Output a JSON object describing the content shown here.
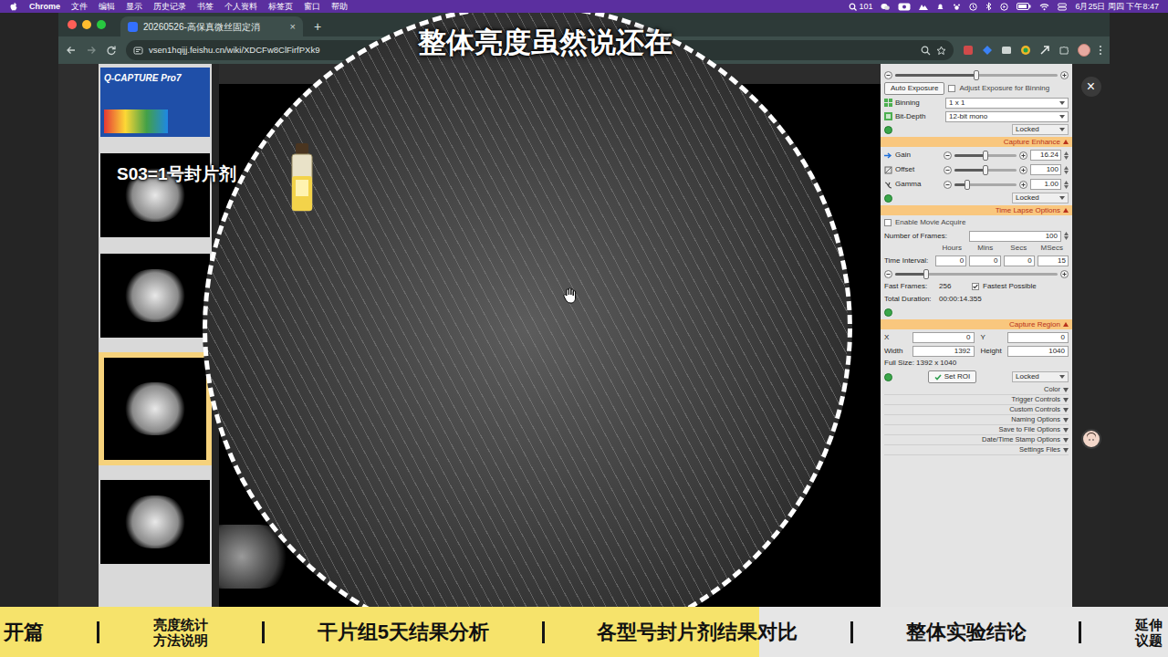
{
  "menubar": {
    "app": "Chrome",
    "menus": [
      "文件",
      "编辑",
      "显示",
      "历史记录",
      "书签",
      "个人资料",
      "标签页",
      "窗口",
      "帮助"
    ],
    "badge": "101",
    "clock": "6月25日 周四 下午8:47"
  },
  "browser": {
    "tabs": [
      {
        "title": "20260526-高保真微丝固定消",
        "selected": true
      }
    ],
    "tab_close": "×",
    "new_tab": "+",
    "url": "vsen1hqijj.feishu.cn/wiki/XDCFw8ClFirfPXk9"
  },
  "viewer": {
    "close": "×",
    "thumbnails": [
      {
        "kind": "logo",
        "label": "Q-CAPTURE Pro7",
        "selected": false
      },
      {
        "kind": "image",
        "selected": false
      },
      {
        "kind": "image",
        "selected": false
      },
      {
        "kind": "image",
        "selected": true
      },
      {
        "kind": "image",
        "selected": false
      }
    ]
  },
  "capture_panel": {
    "exposure_slider": {
      "level": 0.5
    },
    "auto_exposure": "Auto Exposure",
    "adjust_binning": {
      "label": "Adjust Exposure for Binning",
      "checked": false
    },
    "binning": {
      "label": "Binning",
      "value": "1 x 1"
    },
    "bit_depth": {
      "label": "Bit-Depth",
      "value": "12-bit mono"
    },
    "lock": "Locked",
    "enhance": {
      "title": "Capture Enhance",
      "sliders": [
        {
          "label": "Gain",
          "value": "16.24",
          "level": 0.5
        },
        {
          "label": "Offset",
          "value": "100",
          "level": 0.5
        },
        {
          "label": "Gamma",
          "value": "1.00",
          "level": 0.2
        }
      ],
      "lock": "Locked"
    },
    "time_lapse": {
      "title": "Time Lapse Options",
      "movie": {
        "label": "Enable Movie Acquire",
        "checked": false
      },
      "frames_label": "Number of Frames:",
      "frames": "100",
      "units": [
        "Hours",
        "Mins",
        "Secs",
        "MSecs"
      ],
      "interval_label": "Time Interval:",
      "interval": [
        "0",
        "0",
        "0",
        "15"
      ],
      "slider": {
        "level": 0.19
      },
      "fast_frames_label": "Fast Frames:",
      "fast_frames": "256",
      "fastest": {
        "label": "Fastest Possible",
        "checked": true
      },
      "duration_label": "Total Duration:",
      "duration": "00:00:14.355"
    },
    "region": {
      "title": "Capture Region",
      "x_label": "X",
      "x": "0",
      "y_label": "Y",
      "y": "0",
      "width_label": "Width",
      "width": "1392",
      "height_label": "Height",
      "height": "1040",
      "full_size": "Full Size: 1392 x 1040",
      "set_roi": "Set ROI",
      "lock": "Locked"
    },
    "sections": [
      "Color",
      "Trigger Controls",
      "Custom Controls",
      "Naming Options",
      "Save to File Options",
      "Date/Time Stamp Options",
      "Settings Files"
    ]
  },
  "overlay": {
    "caption": "整体亮度虽然说还在",
    "label": "S03=1号封片剂"
  },
  "chapters": {
    "progress": {
      "level": 0.65
    },
    "items": [
      {
        "label": "开篇",
        "kind": "inline"
      },
      {
        "label": "亮度统计方法说明",
        "kind": "stacked"
      },
      {
        "label": "干片组5天结果分析",
        "kind": "inline"
      },
      {
        "label": "各型号封片剂结果对比",
        "kind": "inline"
      },
      {
        "label": "整体实验结论",
        "kind": "inline"
      },
      {
        "label": "延伸议题",
        "kind": "stacked"
      }
    ]
  }
}
